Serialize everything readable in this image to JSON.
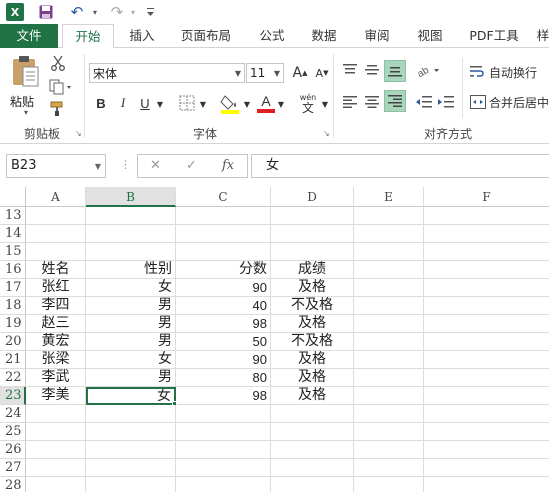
{
  "quick_access": {
    "logo": "X",
    "undo_icon": "↶",
    "redo_icon": "↷",
    "dropdown_icon": "▾"
  },
  "tabs": [
    {
      "label": "文件"
    },
    {
      "label": "开始"
    },
    {
      "label": "插入"
    },
    {
      "label": "页面布局"
    },
    {
      "label": "公式"
    },
    {
      "label": "数据"
    },
    {
      "label": "审阅"
    },
    {
      "label": "视图"
    },
    {
      "label": "PDF工具"
    },
    {
      "label": "样"
    }
  ],
  "ribbon": {
    "clipboard": {
      "paste_label": "粘贴",
      "group_label": "剪贴板"
    },
    "font": {
      "font_name": "宋体",
      "font_size": "11",
      "grow_label": "A",
      "shrink_label": "A",
      "bold": "B",
      "italic": "I",
      "underline": "U",
      "font_color_label": "A",
      "wen_label": "wén",
      "wen_sub": "文",
      "group_label": "字体"
    },
    "alignment": {
      "wrap_text": "自动换行",
      "merge_center": "合并后居中",
      "group_label": "对齐方式"
    },
    "accent_color": "#217346"
  },
  "formula_bar": {
    "name_box": "B23",
    "cancel_icon": "✕",
    "enter_icon": "✓",
    "fx_label": "fx",
    "value": "女"
  },
  "sheet": {
    "columns": [
      "A",
      "B",
      "C",
      "D",
      "E",
      "F"
    ],
    "selected_column": "B",
    "selected_row": "23",
    "rows": [
      {
        "num": "13",
        "cells": [
          "",
          "",
          "",
          ""
        ]
      },
      {
        "num": "14",
        "cells": [
          "",
          "",
          "",
          ""
        ]
      },
      {
        "num": "15",
        "cells": [
          "",
          "",
          "",
          ""
        ]
      },
      {
        "num": "16",
        "cells": [
          "姓名",
          "性别",
          "分数",
          "成绩"
        ]
      },
      {
        "num": "17",
        "cells": [
          "张红",
          "女",
          "90",
          "及格"
        ]
      },
      {
        "num": "18",
        "cells": [
          "李四",
          "男",
          "40",
          "不及格"
        ]
      },
      {
        "num": "19",
        "cells": [
          "赵三",
          "男",
          "98",
          "及格"
        ]
      },
      {
        "num": "20",
        "cells": [
          "黄宏",
          "男",
          "50",
          "不及格"
        ]
      },
      {
        "num": "21",
        "cells": [
          "张梁",
          "女",
          "90",
          "及格"
        ]
      },
      {
        "num": "22",
        "cells": [
          "李武",
          "男",
          "80",
          "及格"
        ]
      },
      {
        "num": "23",
        "cells": [
          "李美",
          "女",
          "98",
          "及格"
        ]
      },
      {
        "num": "24",
        "cells": [
          "",
          "",
          "",
          ""
        ]
      },
      {
        "num": "25",
        "cells": [
          "",
          "",
          "",
          ""
        ]
      },
      {
        "num": "26",
        "cells": [
          "",
          "",
          "",
          ""
        ]
      },
      {
        "num": "27",
        "cells": [
          "",
          "",
          "",
          ""
        ]
      },
      {
        "num": "28",
        "cells": [
          "",
          "",
          "",
          ""
        ]
      }
    ]
  }
}
